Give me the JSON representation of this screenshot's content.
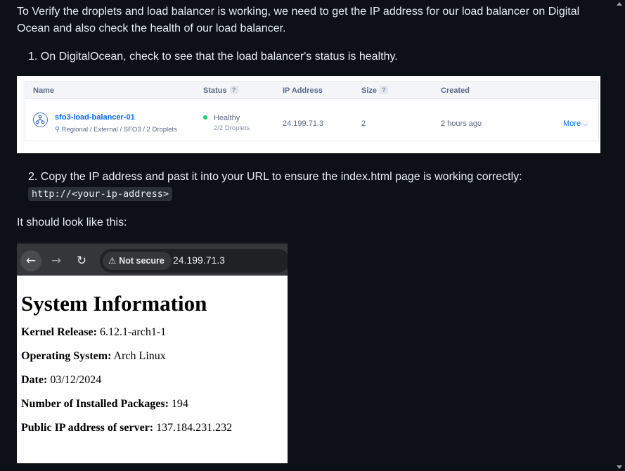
{
  "intro": "To Verify the droplets and load balancer is working, we need to get the IP address for our load balancer on Digital Ocean and also check the health of our load balancer.",
  "steps": {
    "step1": "1. On DigitalOcean, check to see that the load balancer's status is healthy.",
    "step2_text": "2. Copy the IP address and past it into your URL to ensure the index.html page is working correctly: ",
    "step2_code": "http://<your-ip-address>"
  },
  "looks_like": "It should look like this:",
  "lb_table": {
    "headers": {
      "name": "Name",
      "status": "Status",
      "ip": "IP Address",
      "size": "Size",
      "created": "Created"
    },
    "help_icon": "?",
    "row": {
      "name": "sfo3-load-balancer-01",
      "meta": "Regional / External / SFO3 / 2 Droplets",
      "status": "Healthy",
      "droplets": "2/2 Droplets",
      "ip": "24.199.71.3",
      "size": "2",
      "created": "2 hours ago",
      "more": "More"
    },
    "status_color": "#15cd72",
    "link_color": "#0069ff"
  },
  "browser": {
    "back_icon": "←",
    "forward_icon": "→",
    "reload_icon": "↻",
    "warning_icon": "⚠",
    "not_secure": "Not secure",
    "url": "24.199.71.3",
    "page": {
      "title": "System Information",
      "fields": [
        {
          "label": "Kernel Release:",
          "value": " 6.12.1-arch1-1"
        },
        {
          "label": "Operating System:",
          "value": " Arch Linux"
        },
        {
          "label": "Date:",
          "value": " 03/12/2024"
        },
        {
          "label": "Number of Installed Packages:",
          "value": " 194"
        },
        {
          "label": "Public IP address of server:",
          "value": " 137.184.231.232"
        }
      ]
    }
  }
}
